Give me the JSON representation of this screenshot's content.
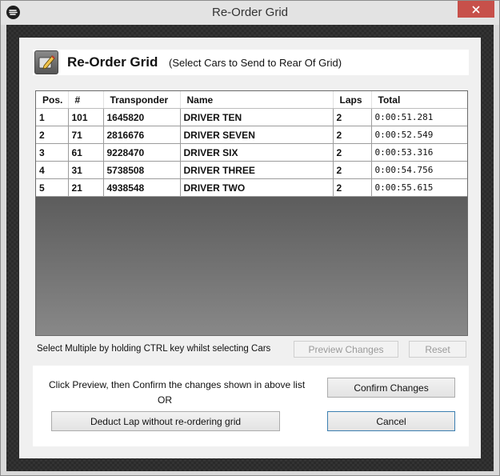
{
  "window": {
    "title": "Re-Order Grid"
  },
  "header": {
    "title": "Re-Order Grid",
    "subtitle": "(Select Cars to Send to Rear Of Grid)"
  },
  "grid": {
    "columns": [
      "Pos.",
      "#",
      "Transponder",
      "Name",
      "Laps",
      "Total"
    ],
    "rows": [
      [
        "1",
        "101",
        "1645820",
        "DRIVER TEN",
        "2",
        "0:00:51.281"
      ],
      [
        "2",
        "71",
        "2816676",
        "DRIVER SEVEN",
        "2",
        "0:00:52.549"
      ],
      [
        "3",
        "61",
        "9228470",
        "DRIVER SIX",
        "2",
        "0:00:53.316"
      ],
      [
        "4",
        "31",
        "5738508",
        "DRIVER THREE",
        "2",
        "0:00:54.756"
      ],
      [
        "5",
        "21",
        "4938548",
        "DRIVER TWO",
        "2",
        "0:00:55.615"
      ]
    ]
  },
  "hint": "Select Multiple by holding CTRL key whilst selecting Cars",
  "buttons": {
    "preview": "Preview Changes",
    "reset": "Reset",
    "confirm": "Confirm Changes",
    "deduct": "Deduct Lap without re-ordering grid",
    "cancel": "Cancel"
  },
  "info": {
    "line1": "Click Preview, then Confirm the changes shown in above list",
    "line2": "OR"
  }
}
